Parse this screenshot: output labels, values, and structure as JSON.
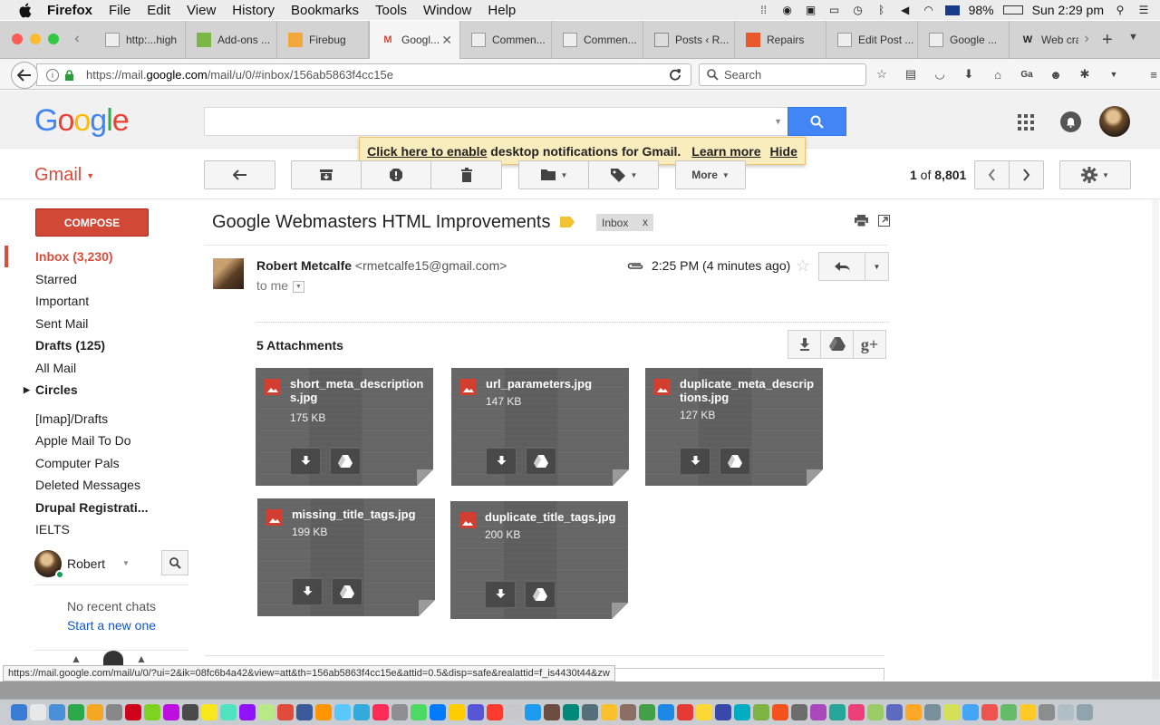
{
  "menubar": {
    "app": "Firefox",
    "items": [
      "File",
      "Edit",
      "View",
      "History",
      "Bookmarks",
      "Tools",
      "Window",
      "Help"
    ],
    "battery": "98%",
    "clock": "Sun 2:29 pm"
  },
  "tabs": [
    {
      "label": "http:...high",
      "icon": "page-icon"
    },
    {
      "label": "Add-ons ...",
      "icon": "puzzle-icon"
    },
    {
      "label": "Firebug",
      "icon": "firebug-icon"
    },
    {
      "label": "Googl...",
      "icon": "gmail-icon",
      "active": true
    },
    {
      "label": "Commen...",
      "icon": "page-icon"
    },
    {
      "label": "Commen...",
      "icon": "page-icon"
    },
    {
      "label": "Posts ‹ R...",
      "icon": "wordpress-icon"
    },
    {
      "label": "Repairs",
      "icon": "magento-icon"
    },
    {
      "label": "Edit Post ...",
      "icon": "page-icon"
    },
    {
      "label": "Google ...",
      "icon": "page-icon"
    },
    {
      "label": "Web cra",
      "icon": "wikipedia-icon"
    }
  ],
  "nav": {
    "url_prefix": "https://mail.",
    "url_domain": "google.com",
    "url_rest": "/mail/u/0/#inbox/156ab5863f4cc15e",
    "search_placeholder": "Search"
  },
  "gmail": {
    "logo": "Google",
    "app_label": "Gmail",
    "notification": {
      "enable_link": "Click here to enable",
      "text": " desktop notifications for Gmail.",
      "learn_more": "Learn more",
      "hide": "Hide"
    },
    "toolbar": {
      "more_label": "More",
      "pager_range": "1",
      "pager_of": " of ",
      "pager_total": "8,801"
    },
    "compose_label": "COMPOSE",
    "folders": [
      {
        "label": "Inbox (3,230)",
        "style": "active"
      },
      {
        "label": "Starred",
        "style": ""
      },
      {
        "label": "Important",
        "style": ""
      },
      {
        "label": "Sent Mail",
        "style": ""
      },
      {
        "label": "Drafts (125)",
        "style": "bold"
      },
      {
        "label": "All Mail",
        "style": ""
      },
      {
        "label": "Circles",
        "style": "bold"
      },
      {
        "label": "[Imap]/Drafts",
        "style": ""
      },
      {
        "label": "Apple Mail To Do",
        "style": ""
      },
      {
        "label": "Computer Pals",
        "style": ""
      },
      {
        "label": "Deleted Messages",
        "style": ""
      },
      {
        "label": "Drupal Registrati...",
        "style": "bold"
      },
      {
        "label": "IELTS",
        "style": ""
      }
    ],
    "chat": {
      "user": "Robert",
      "no_recent": "No recent chats",
      "start_new": "Start a new one"
    },
    "message": {
      "subject": "Google Webmasters HTML Improvements",
      "label_chip": "Inbox",
      "sender_name": "Robert Metcalfe",
      "sender_email": "<rmetcalfe15@gmail.com>",
      "to": "to me",
      "time": "2:25 PM (4 minutes ago)",
      "attachments_title": "5 Attachments",
      "attachments": [
        {
          "name": "short_meta_descriptions.jpg",
          "size": "175 KB"
        },
        {
          "name": "url_parameters.jpg",
          "size": "147 KB"
        },
        {
          "name": "duplicate_meta_descriptions.jpg",
          "size": "127 KB"
        },
        {
          "name": "missing_title_tags.jpg",
          "size": "199 KB"
        },
        {
          "name": "duplicate_title_tags.jpg",
          "size": "200 KB"
        }
      ]
    },
    "status_url": "https://mail.google.com/mail/u/0/?ui=2&ik=08fc6b4a42&view=att&th=156ab5863f4cc15e&attid=0.5&disp=safe&realattid=f_is4430t44&zw"
  },
  "colors": {
    "gmail_red": "#dd4b39",
    "compose_red": "#d14836",
    "search_blue": "#4285f4",
    "link_blue": "#1155cc",
    "notify_bg": "#f9edbe"
  }
}
